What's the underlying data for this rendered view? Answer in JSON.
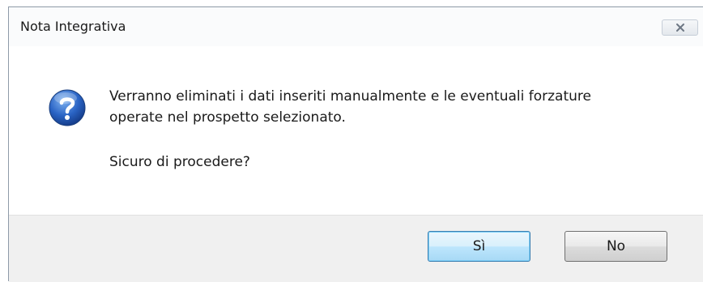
{
  "window": {
    "title": "Nota Integrativa",
    "close_icon": "close-icon"
  },
  "message": {
    "icon": "question-icon",
    "line1": "Verranno eliminati i dati inseriti manualmente e le eventuali forzature",
    "line2": "operate nel prospetto selezionato.",
    "question": "Sicuro di procedere?"
  },
  "buttons": {
    "yes_label": "Sì",
    "no_label": "No"
  },
  "colors": {
    "question_icon": "#2a64c5",
    "default_button_border": "#3c7fb1"
  }
}
